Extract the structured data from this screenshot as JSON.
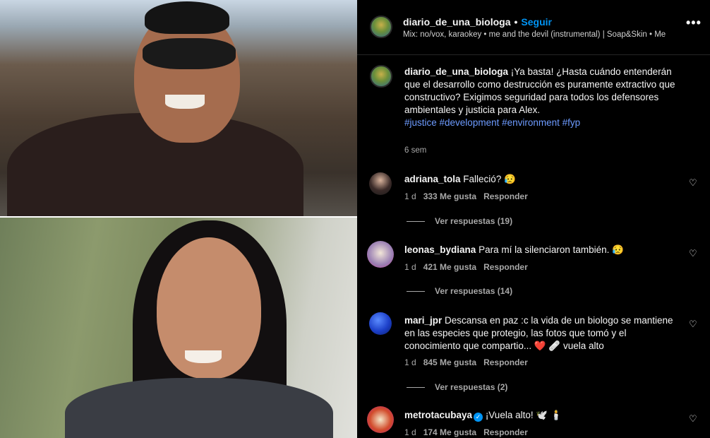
{
  "header": {
    "username": "diario_de_una_biologa",
    "separator": "•",
    "follow_label": "Seguir",
    "music": "Mix: no/vox, karaokey • me and the devil (instrumental) | Soap&Skin • Me",
    "more": "•••"
  },
  "caption": {
    "username": "diario_de_una_biologa",
    "text": " ¡Ya basta! ¿Hasta cuándo entenderán que el desarrollo como destrucción es puramente extractivo que constructivo? Exigimos seguridad para todos los defensores ambientales y justicia para Alex.",
    "hashtags": "#justice #development #environment #fyp",
    "time": "6 sem"
  },
  "comments": [
    {
      "username": "adriana_tola",
      "text": "Falleció? 😥",
      "time": "1 d",
      "likes": "333 Me gusta",
      "reply": "Responder",
      "replies": "Ver respuestas (19)"
    },
    {
      "username": "leonas_bydiana",
      "text": "Para mí la silenciaron también. 😥",
      "time": "1 d",
      "likes": "421 Me gusta",
      "reply": "Responder",
      "replies": "Ver respuestas (14)"
    },
    {
      "username": "mari_jpr",
      "text": "Descansa en paz :c la vida de un biologo se mantiene en las especies que protegio, las fotos que tomó y el conocimiento que compartio... ❤️ 🩹 vuela alto",
      "time": "1 d",
      "likes": "845 Me gusta",
      "reply": "Responder",
      "replies": "Ver respuestas (2)"
    },
    {
      "username": "metrotacubaya",
      "text": "¡Vuela alto! 🕊️ 🕯️",
      "time": "1 d",
      "likes": "174 Me gusta",
      "reply": "Responder",
      "verified": "✓"
    }
  ],
  "icons": {
    "heart": "♡"
  }
}
